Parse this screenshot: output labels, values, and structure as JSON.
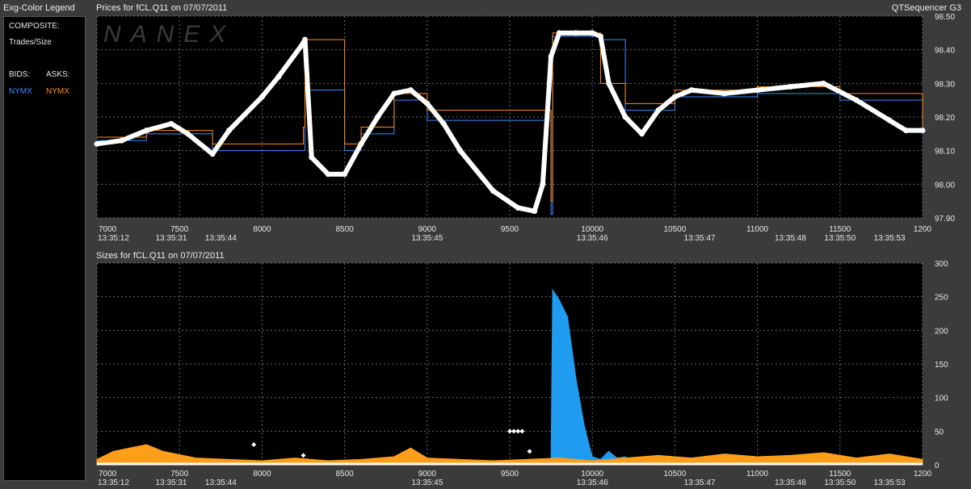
{
  "legend": {
    "title": "Exg-Color Legend",
    "composite_label": "COMPOSITE:",
    "trades_label": "Trades/Size",
    "bids_label": "BIDS:",
    "asks_label": "ASKS:",
    "bid_exchange": "NYMX",
    "ask_exchange": "NYMX",
    "bid_color": "#3d8bff",
    "ask_color": "#ff8c1a"
  },
  "app_name": "QTSequencer G3",
  "watermark": "NANEX",
  "chart_data": [
    {
      "type": "line",
      "title": "Prices for  fCL.Q11  on  07/07/2011",
      "x_ticks": [
        "7000",
        "7500",
        "8000",
        "8500",
        "9000",
        "9500",
        "10000",
        "10500",
        "11000",
        "11500",
        "1200"
      ],
      "x_range": [
        7000,
        12000
      ],
      "time_labels": [
        {
          "x": 7100,
          "label": "13:35:12"
        },
        {
          "x": 7450,
          "label": "13:35:31"
        },
        {
          "x": 7750,
          "label": "13:35:44"
        },
        {
          "x": 9000,
          "label": "13:35:45"
        },
        {
          "x": 10000,
          "label": "13:35:46"
        },
        {
          "x": 10650,
          "label": "13:35:47"
        },
        {
          "x": 11200,
          "label": "13:35:48"
        },
        {
          "x": 11500,
          "label": "13:35:50"
        },
        {
          "x": 11800,
          "label": "13:35:53"
        }
      ],
      "y_ticks": [
        "98.50",
        "98.40",
        "98.30",
        "98.20",
        "98.10",
        "98.00",
        "97.90"
      ],
      "ylim": [
        97.9,
        98.5
      ],
      "series": [
        {
          "name": "Trades/Size",
          "color": "#ffffff",
          "x": [
            7000,
            7150,
            7300,
            7450,
            7550,
            7700,
            7800,
            8000,
            8100,
            8250,
            8260,
            8300,
            8400,
            8500,
            8600,
            8700,
            8800,
            8900,
            9000,
            9100,
            9200,
            9400,
            9550,
            9650,
            9700,
            9750,
            9800,
            9900,
            10000,
            10050,
            10100,
            10200,
            10300,
            10400,
            10500,
            10600,
            10800,
            11000,
            11200,
            11400,
            11600,
            11800,
            11900,
            12000
          ],
          "y": [
            98.12,
            98.13,
            98.16,
            98.18,
            98.15,
            98.09,
            98.16,
            98.26,
            98.32,
            98.42,
            98.43,
            98.08,
            98.03,
            98.03,
            98.12,
            98.2,
            98.27,
            98.28,
            98.24,
            98.18,
            98.1,
            97.98,
            97.93,
            97.92,
            98.0,
            98.38,
            98.45,
            98.45,
            98.45,
            98.44,
            98.3,
            98.2,
            98.15,
            98.22,
            98.26,
            98.28,
            98.27,
            98.28,
            98.29,
            98.3,
            98.25,
            98.19,
            98.16,
            98.16
          ]
        },
        {
          "name": "NYMX",
          "color": "#3d8bff",
          "x": [
            7000,
            7300,
            7700,
            8250,
            8260,
            8500,
            8600,
            8800,
            9000,
            9650,
            9750,
            9760,
            10050,
            10200,
            10500,
            11000,
            11500,
            12000
          ],
          "y": [
            98.13,
            98.15,
            98.1,
            98.1,
            98.28,
            98.1,
            98.15,
            98.25,
            98.19,
            98.19,
            97.91,
            98.44,
            98.43,
            98.22,
            98.26,
            98.27,
            98.25,
            98.15
          ],
          "step": true
        },
        {
          "name": "NYMX",
          "color": "#ff8c1a",
          "x": [
            7000,
            7300,
            7700,
            8250,
            8260,
            8500,
            8600,
            8800,
            9000,
            9650,
            9750,
            9760,
            10050,
            10200,
            10500,
            11000,
            11500,
            12000
          ],
          "y": [
            98.14,
            98.16,
            98.12,
            98.17,
            98.43,
            98.12,
            98.17,
            98.27,
            98.22,
            98.22,
            97.95,
            98.45,
            98.3,
            98.24,
            98.28,
            98.29,
            98.27,
            98.17
          ],
          "step": true
        }
      ]
    },
    {
      "type": "area",
      "title": "Sizes for  fCL.Q11  on  07/07/2011",
      "x_ticks": [
        "7000",
        "7500",
        "8000",
        "8500",
        "9000",
        "9500",
        "10000",
        "10500",
        "11000",
        "11500",
        "1200"
      ],
      "x_range": [
        7000,
        12000
      ],
      "time_labels": [
        {
          "x": 7100,
          "label": "13:35:12"
        },
        {
          "x": 7450,
          "label": "13:35:31"
        },
        {
          "x": 7750,
          "label": "13:35:44"
        },
        {
          "x": 9000,
          "label": "13:35:45"
        },
        {
          "x": 10000,
          "label": "13:35:46"
        },
        {
          "x": 10650,
          "label": "13:35:47"
        },
        {
          "x": 11200,
          "label": "13:35:48"
        },
        {
          "x": 11500,
          "label": "13:35:50"
        },
        {
          "x": 11800,
          "label": "13:35:53"
        }
      ],
      "y_ticks": [
        "300",
        "250",
        "200",
        "150",
        "100",
        "50",
        "0"
      ],
      "ylim": [
        0,
        300
      ],
      "series": [
        {
          "name": "NYMX",
          "color": "#1f9bf0",
          "x": [
            9750,
            9760,
            9800,
            9850,
            9900,
            9950,
            9980,
            10000,
            10050,
            10100,
            10150,
            10200,
            10250
          ],
          "y": [
            0,
            260,
            245,
            220,
            130,
            60,
            30,
            12,
            8,
            20,
            10,
            12,
            0
          ]
        },
        {
          "name": "NYMX",
          "color": "#ff9e1a",
          "x": [
            7000,
            7100,
            7200,
            7300,
            7400,
            7500,
            7600,
            7800,
            8000,
            8200,
            8400,
            8600,
            8800,
            8900,
            9000,
            9200,
            9400,
            9600,
            9800,
            10000,
            10200,
            10400,
            10600,
            10800,
            11000,
            11200,
            11400,
            11600,
            11800,
            12000
          ],
          "y": [
            8,
            20,
            25,
            30,
            20,
            15,
            10,
            8,
            6,
            10,
            6,
            8,
            12,
            25,
            10,
            8,
            6,
            8,
            10,
            6,
            10,
            14,
            10,
            16,
            12,
            14,
            18,
            10,
            16,
            8
          ]
        }
      ],
      "markers": {
        "color": "#ffffff",
        "x": [
          7950,
          8250,
          9500,
          9525,
          9550,
          9575,
          9620
        ],
        "y": [
          30,
          14,
          50,
          50,
          50,
          50,
          20
        ]
      }
    }
  ]
}
